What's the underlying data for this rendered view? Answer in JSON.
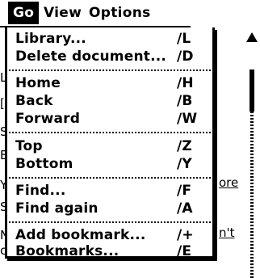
{
  "menubar": {
    "items": [
      {
        "label": "Go"
      },
      {
        "label": "View"
      },
      {
        "label": "Options"
      }
    ]
  },
  "go_menu": {
    "items": [
      {
        "label": "Library...",
        "shortcut": "∕L"
      },
      {
        "label": "Delete document...",
        "shortcut": "∕D"
      },
      {
        "label": "Home",
        "shortcut": "∕H"
      },
      {
        "label": "Back",
        "shortcut": "∕B"
      },
      {
        "label": "Forward",
        "shortcut": "∕W"
      },
      {
        "label": "Top",
        "shortcut": "∕Z"
      },
      {
        "label": "Bottom",
        "shortcut": "∕Y"
      },
      {
        "label": "Find...",
        "shortcut": "∕F"
      },
      {
        "label": "Find again",
        "shortcut": "∕A"
      },
      {
        "label": "Add bookmark...",
        "shortcut": "∕+"
      },
      {
        "label": "Bookmarks...",
        "shortcut": "∕E"
      }
    ]
  },
  "background": {
    "fragments": [
      "L",
      "[",
      "S",
      "E",
      "Y",
      "S",
      "N",
      "c"
    ],
    "links": [
      "ore",
      "n't"
    ]
  }
}
